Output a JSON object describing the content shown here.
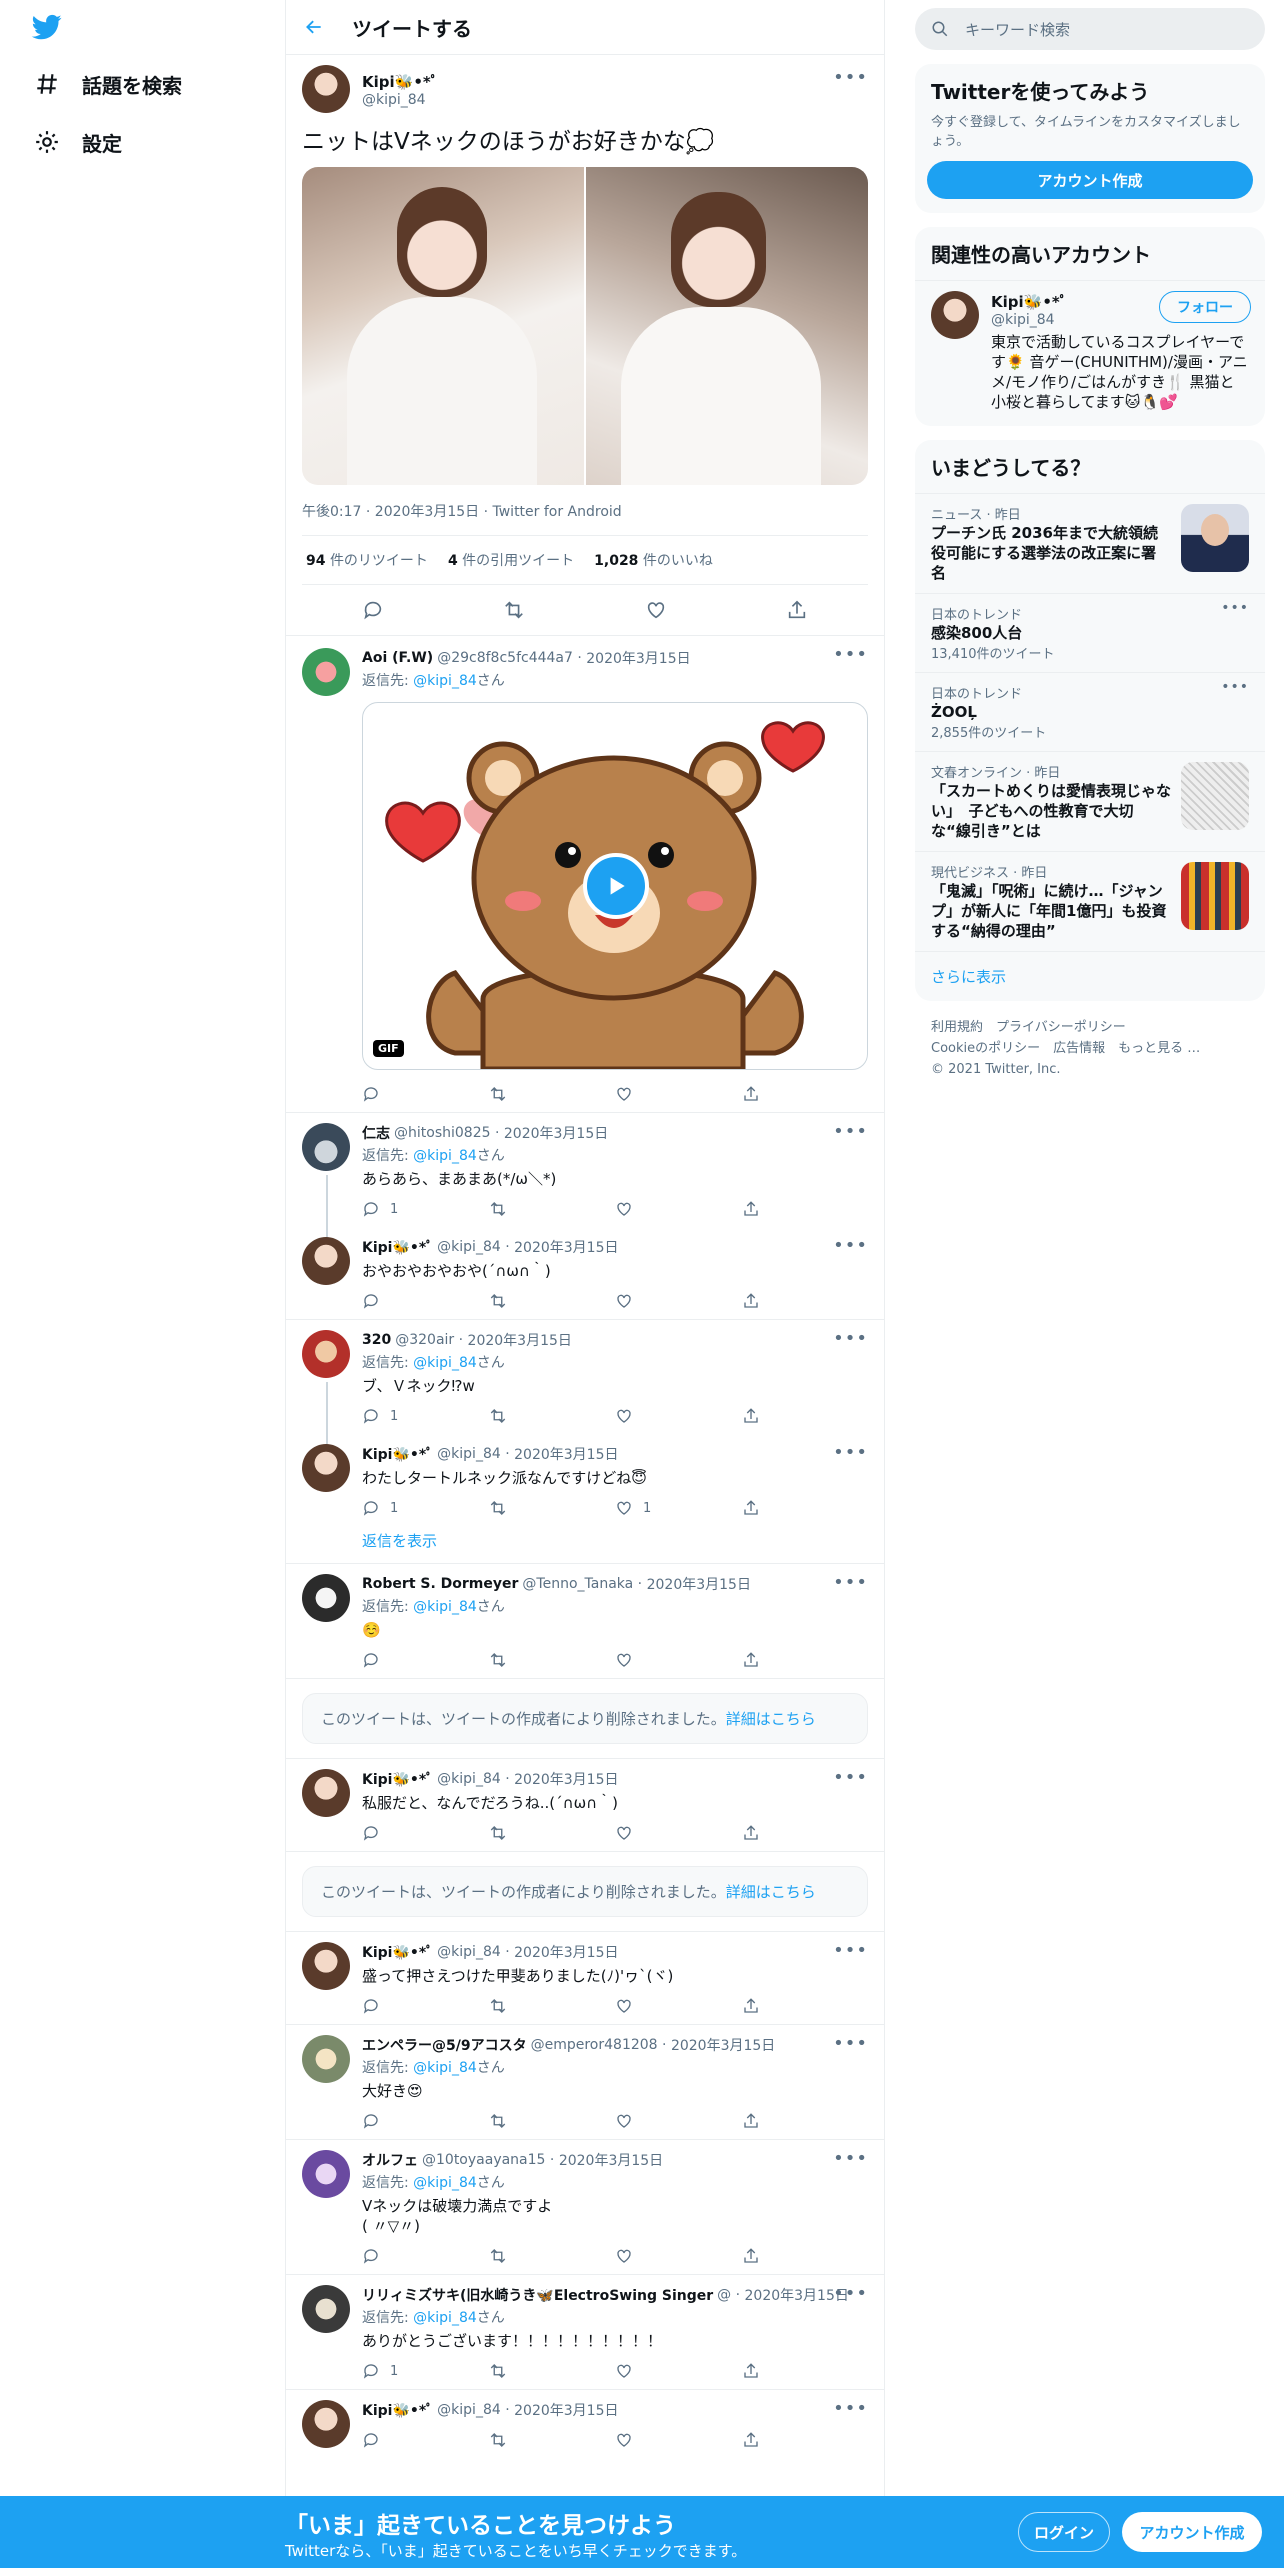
{
  "nav": {
    "explore": "話題を検索",
    "settings": "設定"
  },
  "header": {
    "title": "ツイートする"
  },
  "main_tweet": {
    "name": "Kipi🐝•*ﾟ",
    "handle": "@kipi_84",
    "text": "ニットはVネックのほうがお好きかな💭",
    "timestamp": "午後0:17 · 2020年3月15日 · Twitter for Android",
    "stats": [
      {
        "num": "94",
        "label": "件のリツイート"
      },
      {
        "num": "4",
        "label": "件の引用ツイート"
      },
      {
        "num": "1,028",
        "label": "件のいいね"
      }
    ]
  },
  "gif_badge": "GIF",
  "reply_prefix": "返信先: ",
  "reply_suffix": "さん",
  "show_replies": "返信を表示",
  "deleted": {
    "text": "このツイートは、ツイートの作成者により削除されました。",
    "link": "詳細はこちら"
  },
  "tweets": [
    {
      "name": "Aoi (F.W)",
      "handle": "@29c8f8c5fc444a7",
      "date": "2020年3月15日",
      "reply_to": "@kipi_84",
      "text": "",
      "reply_count": "",
      "like_count": ""
    },
    {
      "name": "仁志",
      "handle": "@hitoshi0825",
      "date": "2020年3月15日",
      "reply_to": "@kipi_84",
      "text": "あらあら、まあまあ(*/ω＼*)",
      "reply_count": "1",
      "like_count": ""
    },
    {
      "name": "Kipi🐝•*ﾟ",
      "handle": "@kipi_84",
      "date": "2020年3月15日",
      "reply_to": "",
      "text": "おやおやおやおや(´∩ω∩｀)",
      "reply_count": "",
      "like_count": ""
    },
    {
      "name": "320",
      "handle": "@320air",
      "date": "2020年3月15日",
      "reply_to": "@kipi_84",
      "text": "ブ、Ｖネック⁉w",
      "reply_count": "1",
      "like_count": ""
    },
    {
      "name": "Kipi🐝•*ﾟ",
      "handle": "@kipi_84",
      "date": "2020年3月15日",
      "reply_to": "",
      "text": "わたしタートルネック派なんですけどね😇",
      "reply_count": "1",
      "like_count": "1"
    },
    {
      "name": "Robert S. Dormeyer",
      "handle": "@Tenno_Tanaka",
      "date": "2020年3月15日",
      "reply_to": "@kipi_84",
      "text": "☺️",
      "reply_count": "",
      "like_count": ""
    },
    {
      "name": "Kipi🐝•*ﾟ",
      "handle": "@kipi_84",
      "date": "2020年3月15日",
      "reply_to": "",
      "text": "私服だと、なんでだろうね..(´∩ω∩｀)",
      "reply_count": "",
      "like_count": ""
    },
    {
      "name": "Kipi🐝•*ﾟ",
      "handle": "@kipi_84",
      "date": "2020年3月15日",
      "reply_to": "",
      "text": "盛って押さえつけた甲斐ありました(ﾉ)'ヮ`(ヾ)",
      "reply_count": "",
      "like_count": ""
    },
    {
      "name": "エンペラー@5/9アコスタ",
      "handle": "@emperor481208",
      "date": "2020年3月15日",
      "reply_to": "@kipi_84",
      "text": "大好き😍",
      "reply_count": "",
      "like_count": ""
    },
    {
      "name": "オルフェ",
      "handle": "@10toyaayana15",
      "date": "2020年3月15日",
      "reply_to": "@kipi_84",
      "text": "Vネックは破壊力満点ですよ",
      "text2": "( 〃▽〃)",
      "reply_count": "",
      "like_count": ""
    },
    {
      "name": "リリィミズサキ(旧水崎うき🦋ElectroSwing Singer",
      "handle": "@",
      "date": "2020年3月15日",
      "reply_to": "@kipi_84",
      "text": "ありがとうございます！！！！！！！！！！",
      "reply_count": "1",
      "like_count": ""
    },
    {
      "name": "Kipi🐝•*ﾟ",
      "handle": "@kipi_84",
      "date": "2020年3月15日",
      "reply_to": "",
      "text": "",
      "reply_count": "",
      "like_count": ""
    }
  ],
  "right": {
    "search_placeholder": "キーワード検索",
    "signup": {
      "title": "Twitterを使ってみよう",
      "desc": "今すぐ登録して、タイムラインをカスタマイズしましょう。",
      "button": "アカウント作成"
    },
    "related": {
      "title": "関連性の高いアカウント",
      "name": "Kipi🐝•*ﾟ",
      "handle": "@kipi_84",
      "follow": "フォロー",
      "bio": "東京で活動しているコスプレイヤーです🌻 音ゲー(CHUNITHM)/漫画・アニメ/モノ作り/ごはんがすき🍴 黒猫と小桜と暮らしてます🐱🐧💕"
    },
    "trends": {
      "title": "いまどうしてる？",
      "items": [
        {
          "meta": "ニュース · 昨日",
          "name": "プーチン氏 2036年まで大統領続役可能にする選挙法の改正案に署名"
        },
        {
          "meta": "日本のトレンド",
          "name": "感染800人台",
          "count": "13,410件のツイート"
        },
        {
          "meta": "日本のトレンド",
          "name": "ŻOOĻ",
          "count": "2,855件のツイート"
        },
        {
          "meta": "文春オンライン · 昨日",
          "name": "「スカートめくりは愛情表現じゃない」　子どもへの性教育で大切な“線引き”とは"
        },
        {
          "meta": "現代ビジネス · 昨日",
          "name": "「鬼滅」「呪術」に続け…「ジャンプ」が新人に「年間1億円」も投資する“納得の理由”"
        }
      ],
      "more": "さらに表示"
    },
    "footer": {
      "line1": "利用規約　プライバシーポリシー",
      "line2": "Cookieのポリシー　広告情報　もっと見る …",
      "copy": "© 2021 Twitter, Inc."
    }
  },
  "bottom": {
    "title": "「いま」起きていることを見つけよう",
    "sub": "Twitterなら、「いま」起きていることをいち早くチェックできます。",
    "login": "ログイン",
    "signup": "アカウント作成"
  },
  "colors": {
    "accent": "#1da1f2",
    "text": "#0f1419",
    "muted": "#5b7083",
    "bottom_bar": "#1da1f2"
  }
}
